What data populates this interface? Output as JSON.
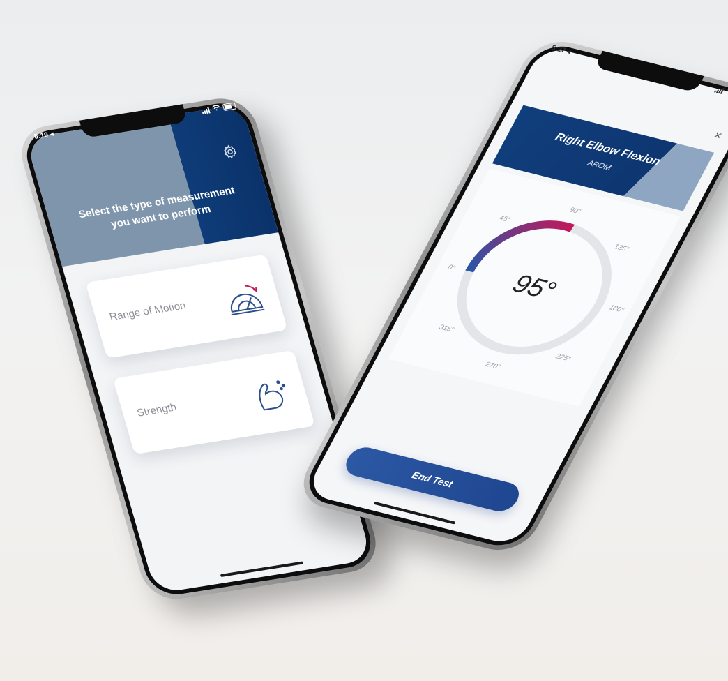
{
  "left_phone": {
    "status": {
      "time": "5:19 ◂"
    },
    "header": {
      "title_line1": "Select the type of measurement",
      "title_line2": "you want to perform",
      "settings_icon": "gear-icon"
    },
    "cards": [
      {
        "label": "Range of Motion",
        "icon": "protractor-icon"
      },
      {
        "label": "Strength",
        "icon": "flexed-arm-icon"
      }
    ]
  },
  "right_phone": {
    "status": {
      "time": "5:27 ◂"
    },
    "close_label": "×",
    "banner": {
      "title": "Right Elbow Flexion",
      "subtitle": "AROM"
    },
    "gauge": {
      "value_text": "95°",
      "value": 95,
      "ticks": [
        {
          "angle": 0,
          "label": "0°"
        },
        {
          "angle": 45,
          "label": "45°"
        },
        {
          "angle": 90,
          "label": "90°"
        },
        {
          "angle": 135,
          "label": "135°"
        },
        {
          "angle": 180,
          "label": "180°"
        },
        {
          "angle": 225,
          "label": "225°"
        },
        {
          "angle": 270,
          "label": "270°"
        },
        {
          "angle": 315,
          "label": "315°"
        }
      ],
      "colors": {
        "track": "#e3e5e8",
        "arc_start": "#2b55a6",
        "arc_end": "#c2185b"
      }
    },
    "end_button": "End Test"
  },
  "colors": {
    "navy": "#0e3c78",
    "steel": "#7f95ac",
    "accent": "#2c58a4"
  }
}
